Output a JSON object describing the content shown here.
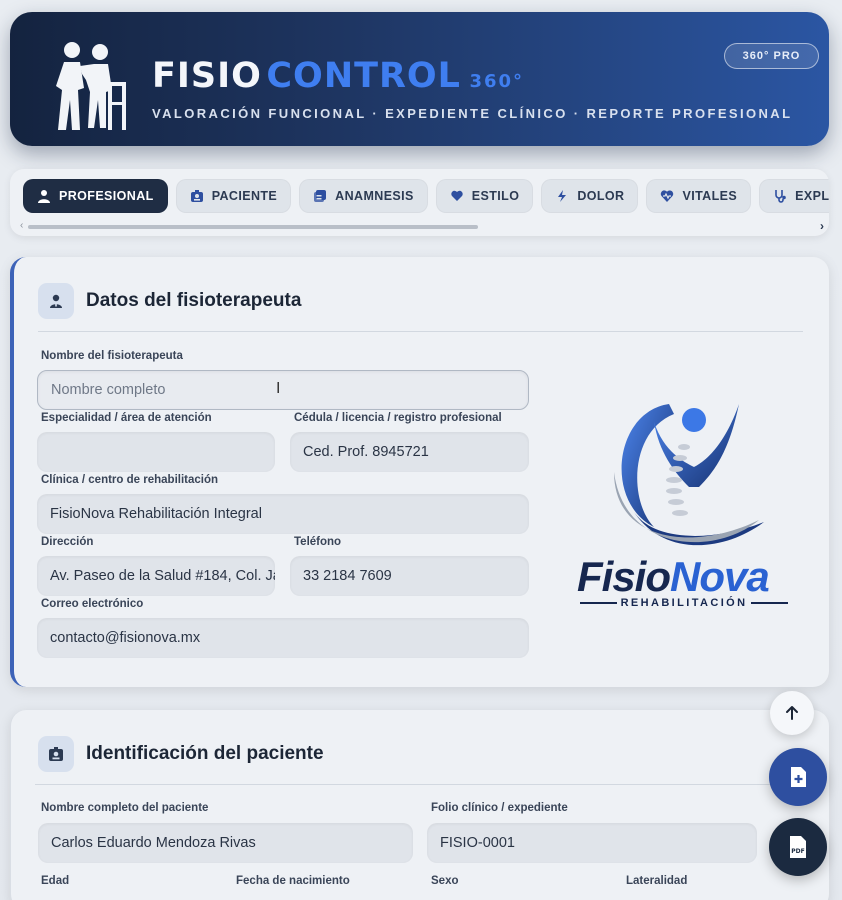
{
  "header": {
    "brand_part1": "FISIO",
    "brand_part2": "CONTROL",
    "brand_part3": "360°",
    "tagline": "VALORACIÓN FUNCIONAL · EXPEDIENTE CLÍNICO · REPORTE PROFESIONAL",
    "badge": "360° PRO",
    "logo_icon": "physio-assist-icon"
  },
  "tabs": [
    {
      "label": "PROFESIONAL",
      "icon": "user-md-icon",
      "active": true
    },
    {
      "label": "PACIENTE",
      "icon": "id-card-icon",
      "active": false
    },
    {
      "label": "ANAMNESIS",
      "icon": "notes-icon",
      "active": false
    },
    {
      "label": "ESTILO",
      "icon": "heart-hand-icon",
      "active": false
    },
    {
      "label": "DOLOR",
      "icon": "bolt-icon",
      "active": false
    },
    {
      "label": "VITALES",
      "icon": "heart-pulse-icon",
      "active": false
    },
    {
      "label": "EXPLORACIÓN",
      "icon": "stethoscope-icon",
      "active": false
    }
  ],
  "professional": {
    "title": "Datos del fisioterapeuta",
    "name_label": "Nombre del fisioterapeuta",
    "name_placeholder": "Nombre completo",
    "specialty_label": "Especialidad / área de atención",
    "specialty_value": "",
    "license_label": "Cédula / licencia / registro profesional",
    "license_value": "Ced. Prof. 8945721",
    "clinic_label": "Clínica / centro de rehabilitación",
    "clinic_value": "FisioNova Rehabilitación Integral",
    "address_label": "Dirección",
    "address_value": "Av. Paseo de la Salud #184, Col. Ja",
    "phone_label": "Teléfono",
    "phone_value": "33 2184 7609",
    "email_label": "Correo electrónico",
    "email_value": "contacto@fisionova.mx"
  },
  "clinic_logo": {
    "name_part1": "Fisio",
    "name_part2": "Nova",
    "subtitle": "REHABILITACIÓN"
  },
  "patient": {
    "title": "Identificación del paciente",
    "name_label": "Nombre completo del paciente",
    "name_value": "Carlos Eduardo Mendoza Rivas",
    "folio_label": "Folio clínico / expediente",
    "folio_value": "FISIO-0001",
    "age_label": "Edad",
    "dob_label": "Fecha de nacimiento",
    "sex_label": "Sexo",
    "laterality_label": "Lateralidad"
  },
  "colors": {
    "accent": "#3f7ef0",
    "header_dark": "#14233f",
    "active_tab": "#1f2d44",
    "fab_blue": "#2e4fa0"
  }
}
